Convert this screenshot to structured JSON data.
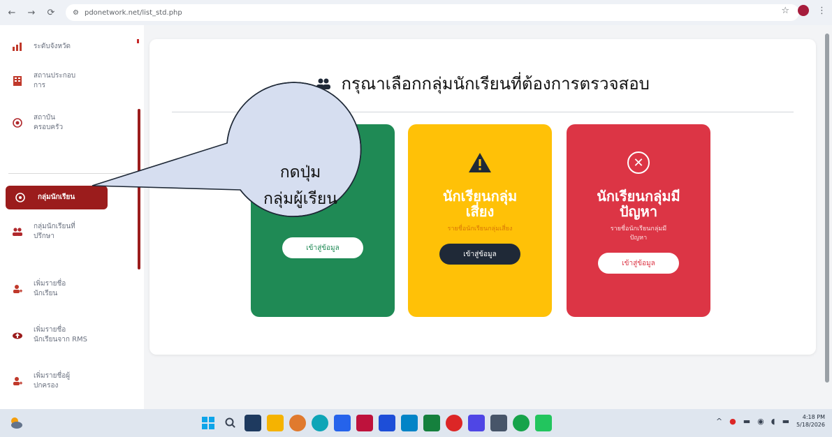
{
  "browser": {
    "url": "pdonetwork.net/list_std.php",
    "back_icon": "arrow-left-icon",
    "forward_icon": "arrow-right-icon",
    "reload_icon": "reload-icon"
  },
  "sidebar": {
    "items": [
      {
        "label": "ระดับจังหวัด",
        "icon": "chart-icon"
      },
      {
        "label": "สถานประกอบ\nการ",
        "icon": "building-icon"
      },
      {
        "label": "สถาบัน\nครอบครัว",
        "icon": "target-icon"
      },
      {
        "label": "กลุ่มนักเรียน",
        "icon": "circle-icon",
        "active": true
      },
      {
        "label": "กลุ่มนักเรียนที่\nปรึกษา",
        "icon": "users-icon"
      },
      {
        "label": "เพิ่มรายชื่อ\nนักเรียน",
        "icon": "user-add-icon"
      },
      {
        "label": "เพิ่มรายชื่อ\nนักเรียนจาก RMS",
        "icon": "cloud-upload-icon"
      },
      {
        "label": "เพิ่มรายชื่อผู้\nปกครอง",
        "icon": "user-add-icon"
      }
    ]
  },
  "main": {
    "heading": "กรุณาเลือกกลุ่มนักเรียนที่ต้องการตรวจสอบ",
    "cards": [
      {
        "title": "",
        "desc": "",
        "button": "เข้าสู่ข้อมูล",
        "color": "#1f8a55"
      },
      {
        "title": "นักเรียนกลุ่ม\nเสี่ยง",
        "desc": "รายชื่อนักเรียนกลุ่มเสี่ยง",
        "button": "เข้าสู่ข้อมูล",
        "color": "#ffc107"
      },
      {
        "title": "นักเรียนกลุ่มมี\nปัญหา",
        "desc": "รายชื่อนักเรียนกลุ่มมี\nปัญหา",
        "button": "เข้าสู่ข้อมูล",
        "color": "#dc3545"
      }
    ]
  },
  "callout": {
    "text": "กดปุ่ม\nกลุ่มผู้เรียน",
    "fill": "#d6def0"
  },
  "taskbar": {
    "time": "4:18 PM",
    "date": "5/18/2026"
  },
  "colors": {
    "sidebar_active": "#9b1c1c",
    "green": "#1f8a55",
    "yellow": "#ffc107",
    "red": "#dc3545"
  }
}
